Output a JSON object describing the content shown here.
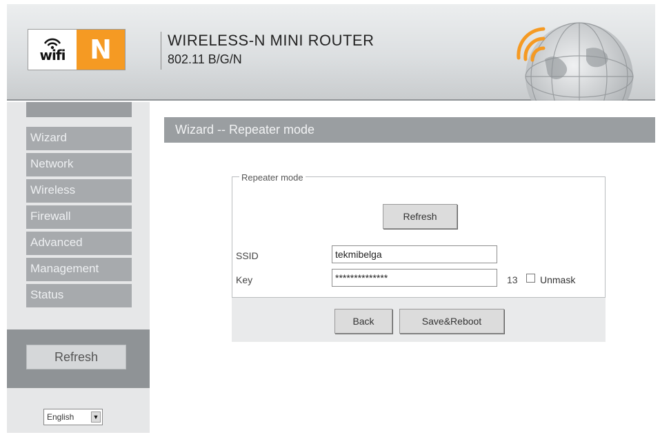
{
  "header": {
    "logo_wifi": "wifi",
    "logo_n": "N",
    "title": "WIRELESS-N MINI ROUTER",
    "subtitle": "802.11 B/G/N"
  },
  "sidebar": {
    "items": [
      {
        "label": "Wizard"
      },
      {
        "label": "Network"
      },
      {
        "label": "Wireless"
      },
      {
        "label": "Firewall"
      },
      {
        "label": "Advanced"
      },
      {
        "label": "Management"
      },
      {
        "label": "Status"
      }
    ],
    "refresh_label": "Refresh",
    "language": "English"
  },
  "main": {
    "page_title": "Wizard -- Repeater mode",
    "fieldset_legend": "Repeater mode",
    "refresh_label": "Refresh",
    "ssid_label": "SSID",
    "ssid_value": "tekmibelga",
    "key_label": "Key",
    "key_value": "**************",
    "key_length": "13",
    "unmask_label": "Unmask",
    "back_label": "Back",
    "save_reboot_label": "Save&Reboot"
  },
  "colors": {
    "logo_orange": "#f59a23",
    "nav_background": "#a7aaad",
    "title_bar": "#9a9ea1"
  },
  "icons": {
    "logo_signal": "wifi-signal-icon",
    "header_art": "globe-icon",
    "dropdown": "chevron-down-icon"
  }
}
